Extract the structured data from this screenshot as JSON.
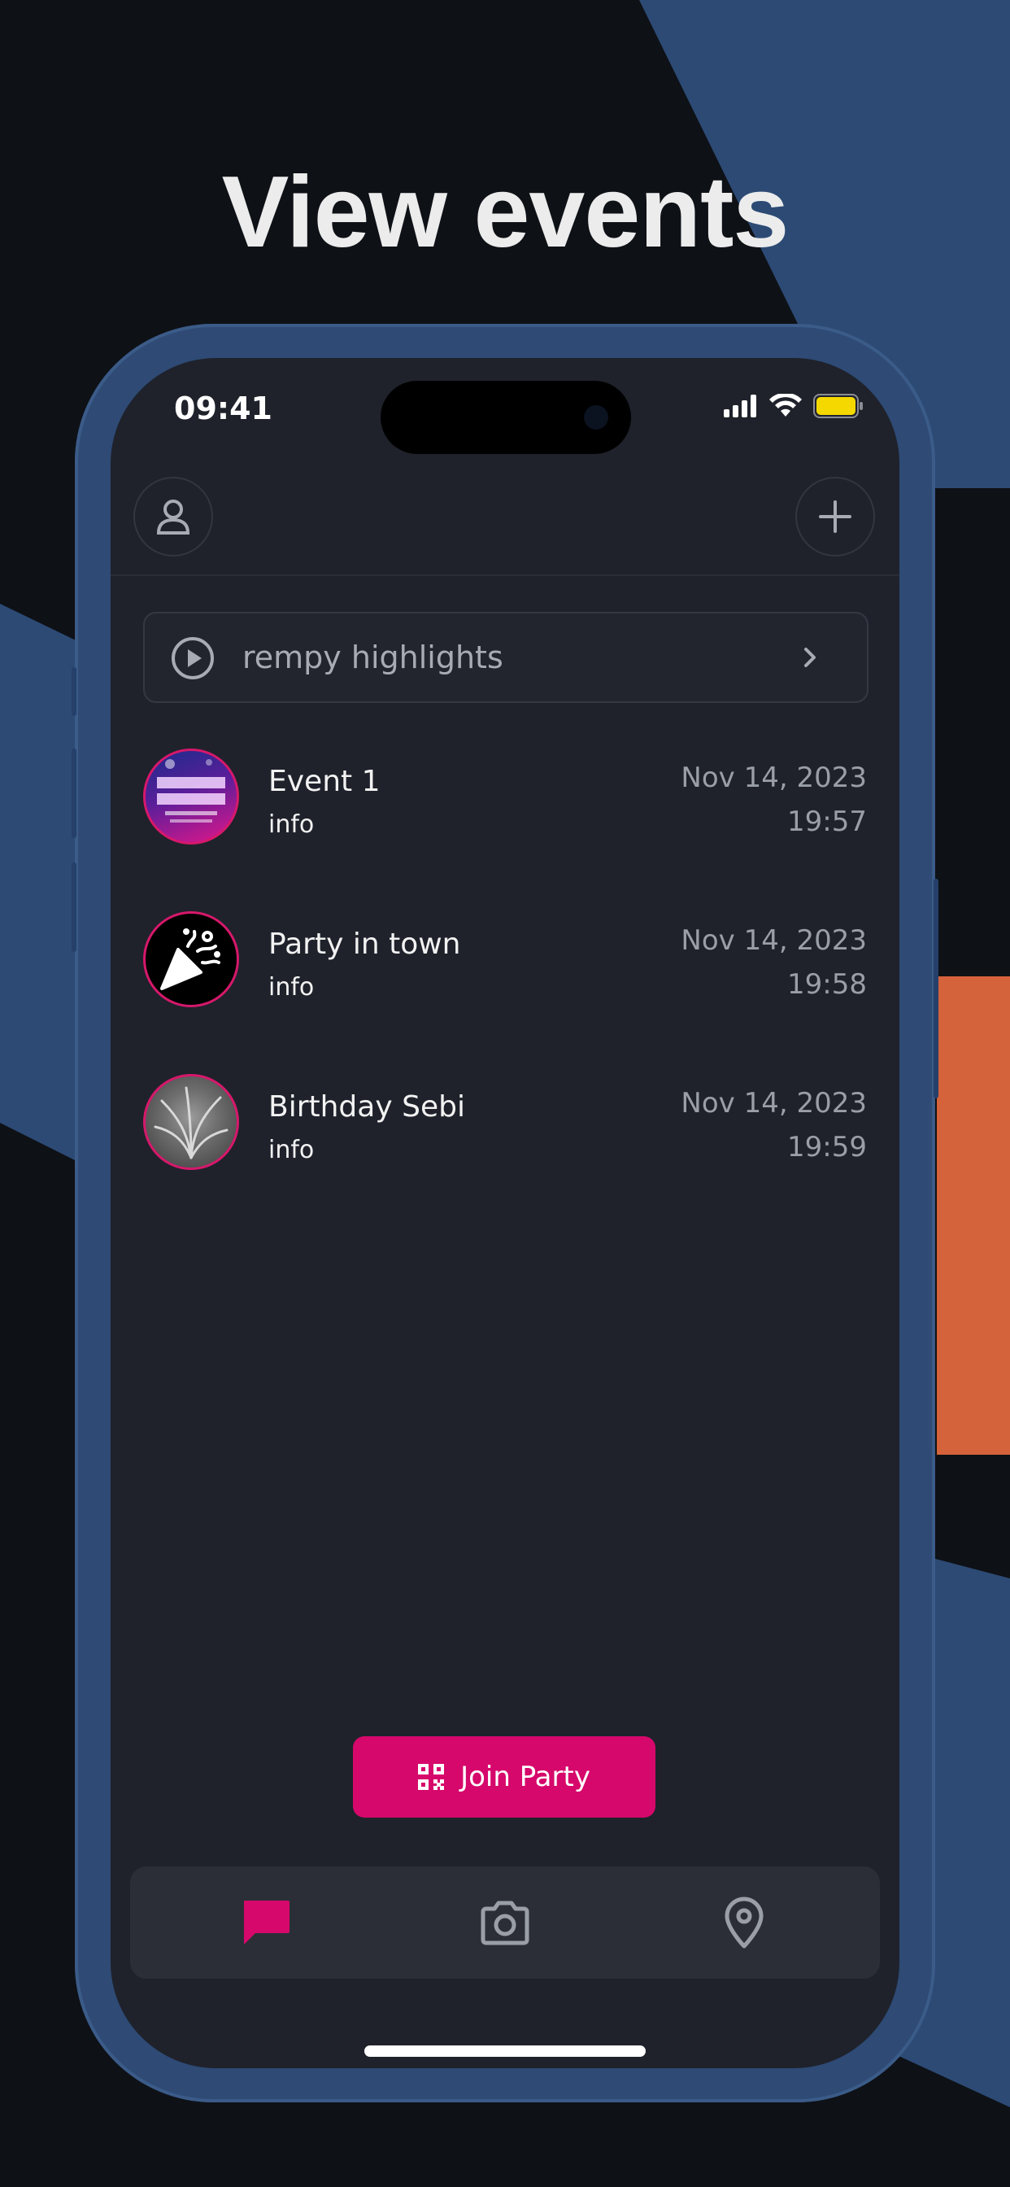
{
  "headline": "View events",
  "side_banner": "",
  "status_bar": {
    "time": "09:41"
  },
  "header": {
    "profile_icon": "person-icon",
    "add_icon": "plus-icon"
  },
  "highlights": {
    "label": "rempy highlights",
    "icon": "play-circle-icon",
    "chevron": "chevron-right-icon"
  },
  "events": [
    {
      "title": "Event 1",
      "subtitle": "info",
      "date": "Nov 14, 2023",
      "time": "19:57"
    },
    {
      "title": "Party in town",
      "subtitle": "info",
      "date": "Nov 14, 2023",
      "time": "19:58"
    },
    {
      "title": "Birthday Sebi",
      "subtitle": "info",
      "date": "Nov 14, 2023",
      "time": "19:59"
    }
  ],
  "join_button": {
    "label": "Join Party",
    "icon": "qr-code-icon"
  },
  "tabbar": {
    "items": [
      {
        "name": "chat",
        "icon": "chat-bubble-icon",
        "active": true
      },
      {
        "name": "camera",
        "icon": "camera-icon",
        "active": false
      },
      {
        "name": "map",
        "icon": "map-pin-icon",
        "active": false
      }
    ]
  },
  "colors": {
    "accent": "#d6086b",
    "background": "#0e1116",
    "phone_frame": "#2e4a75",
    "screen": "#1f222b",
    "banner": "#d4623a"
  }
}
